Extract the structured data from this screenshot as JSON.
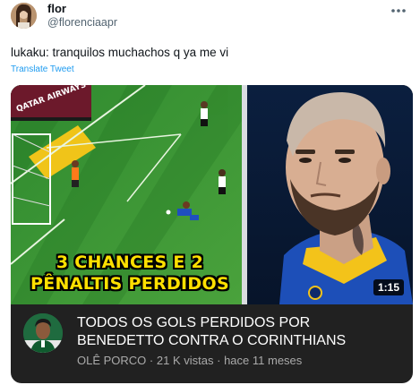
{
  "tweet": {
    "display_name": "flor",
    "handle": "@florenciaapr",
    "text": "lukaku: tranquilos muchachos q ya me vi",
    "translate_label": "Translate Tweet",
    "more_icon": "more-horizontal-icon"
  },
  "video": {
    "thumbnail_caption_line1": "3 CHANCES E 2",
    "thumbnail_caption_line2": "PÊNALTIS PERDIDOS",
    "duration": "1:15",
    "title_line1": "TODOS OS GOLS PERDIDOS POR",
    "title_line2": "BENEDETTO CONTRA O CORINTHIANS",
    "channel": "OLÊ PORCO",
    "meta_separator": "·",
    "views": "21 K vistas",
    "published": "hace 11 meses"
  },
  "colors": {
    "text_primary": "#0f1419",
    "text_secondary": "#536471",
    "link": "#1d9bf0",
    "card_background": "#212121",
    "caption_yellow": "#ffe000"
  }
}
